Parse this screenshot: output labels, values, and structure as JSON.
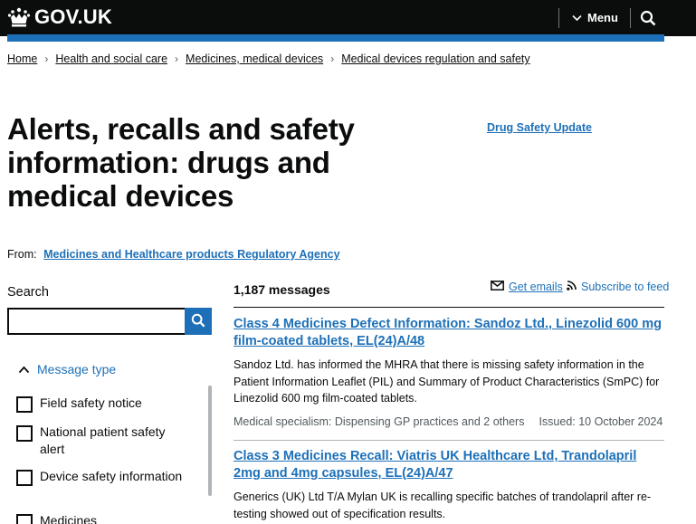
{
  "header": {
    "logo_text": "GOV.UK",
    "menu_label": "Menu"
  },
  "breadcrumbs": [
    "Home",
    "Health and social care",
    "Medicines, medical devices",
    "Medical devices regulation and safety"
  ],
  "page": {
    "title": "Alerts, recalls and safety information: drugs and medical devices",
    "related_link": "Drug Safety Update",
    "from_label": "From:",
    "from_org": "Medicines and Healthcare products Regulatory Agency"
  },
  "search": {
    "label": "Search",
    "value": "",
    "placeholder": ""
  },
  "filters": {
    "toggle_label": "Message type",
    "expanded": true,
    "options": [
      "Field safety notice",
      "National patient safety alert",
      "Device safety information",
      "Medicines"
    ]
  },
  "results": {
    "count": "1,187 messages",
    "get_emails": "Get emails",
    "subscribe_feed": "Subscribe to feed",
    "items": [
      {
        "title": "Class 4 Medicines Defect Information: Sandoz Ltd., Linezolid 600 mg film-coated tablets, EL(24)A/48",
        "description": "Sandoz Ltd. has informed the MHRA that there is missing safety information in the Patient Information Leaflet (PIL) and Summary of Product Characteristics (SmPC) for Linezolid 600 mg film-coated tablets.",
        "specialism": "Medical specialism: Dispensing GP practices and 2 others",
        "issued": "Issued: 10 October 2024"
      },
      {
        "title": "Class 3 Medicines Recall: Viatris UK Healthcare Ltd, Trandolapril 2mg and 4mg capsules, EL(24)A/47",
        "description": "Generics (UK) Ltd T/A Mylan UK is recalling specific batches of trandolapril after re-testing showed out of specification results."
      }
    ]
  },
  "colors": {
    "header_bg": "#0b0c0c",
    "link": "#1d70b8",
    "text": "#0b0c0c",
    "secondary_text": "#505a5f"
  }
}
